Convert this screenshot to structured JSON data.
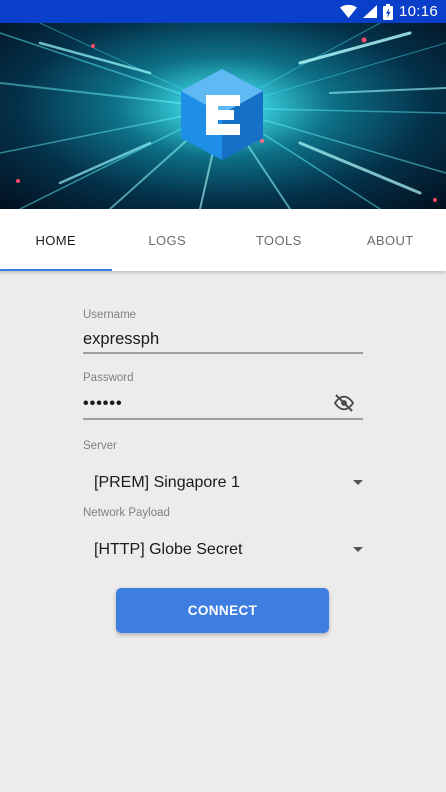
{
  "status_bar": {
    "time": "10:16",
    "icons": [
      "wifi-icon",
      "signal-icon",
      "battery-icon"
    ],
    "color": "#0a3fc9"
  },
  "banner": {
    "logo_letter": "E",
    "logo_color": "#1e8fe6"
  },
  "tabs": [
    {
      "label": "HOME",
      "active": true
    },
    {
      "label": "LOGS",
      "active": false
    },
    {
      "label": "TOOLS",
      "active": false
    },
    {
      "label": "ABOUT",
      "active": false
    }
  ],
  "form": {
    "username": {
      "label": "Username",
      "value": "expressph"
    },
    "password": {
      "label": "Password",
      "value": "••••••",
      "toggle_icon": "eye-off-icon"
    },
    "server": {
      "label": "Server",
      "selected": "[PREM] Singapore 1"
    },
    "payload": {
      "label": "Network Payload",
      "selected": "[HTTP] Globe Secret"
    }
  },
  "connect_button": {
    "label": "CONNECT",
    "color": "#3d7ee0"
  }
}
